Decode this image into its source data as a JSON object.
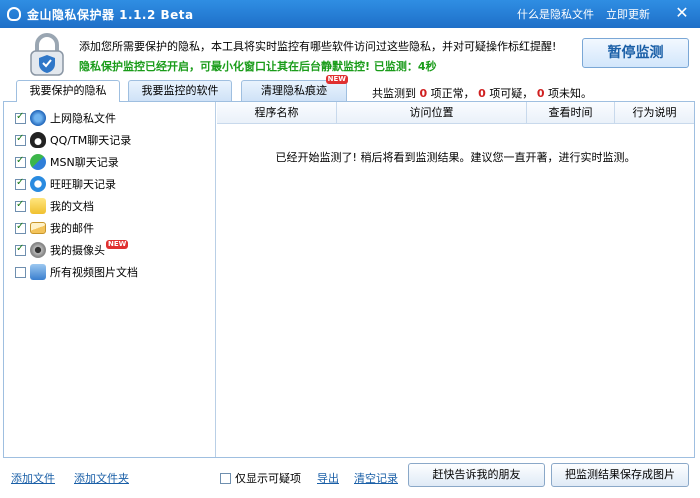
{
  "window": {
    "title": "金山隐私保护器 1.1.2 Beta",
    "link_what": "什么是隐私文件",
    "link_update": "立即更新"
  },
  "header": {
    "description": "添加您所需要保护的隐私，本工具将实时监控有哪些软件访问过这些隐私，并对可疑操作标红提醒!",
    "status": "隐私保护监控已经开启，可最小化窗口让其在后台静默监控! 已监测：4秒",
    "pause_button": "暂停监测"
  },
  "tabs": [
    {
      "label": "我要保护的隐私",
      "active": true
    },
    {
      "label": "我要监控的软件",
      "active": false
    },
    {
      "label": "清理隐私痕迹",
      "active": false,
      "badge": "NEW"
    }
  ],
  "counts": {
    "prefix": "共监测到",
    "normal_count": "0",
    "normal_label": "项正常，",
    "suspicious_count": "0",
    "suspicious_label": "项可疑，",
    "unknown_count": "0",
    "unknown_label": "项未知。"
  },
  "privacy_items": [
    {
      "label": "上网隐私文件",
      "checked": true,
      "icon": "ie-icon"
    },
    {
      "label": "QQ/TM聊天记录",
      "checked": true,
      "icon": "qq-penguin-icon"
    },
    {
      "label": "MSN聊天记录",
      "checked": true,
      "icon": "msn-icon"
    },
    {
      "label": "旺旺聊天记录",
      "checked": true,
      "icon": "wangwang-icon"
    },
    {
      "label": "我的文档",
      "checked": true,
      "icon": "documents-folder-icon"
    },
    {
      "label": "我的邮件",
      "checked": true,
      "icon": "mail-envelope-icon"
    },
    {
      "label": "我的摄像头",
      "checked": true,
      "icon": "webcam-icon",
      "badge": "NEW"
    },
    {
      "label": "所有视频图片文档",
      "checked": false,
      "icon": "media-files-icon"
    }
  ],
  "table": {
    "columns": [
      "程序名称",
      "访问位置",
      "查看时间",
      "行为说明"
    ],
    "empty_message": "已经开始监测了! 稍后将看到监测结果。建议您一直开著，进行实时监测。"
  },
  "footer": {
    "add_file": "添加文件",
    "add_folder": "添加文件夹",
    "only_suspicious": "仅显示可疑项",
    "export": "导出",
    "clear_records": "清空记录",
    "tell_friends": "赶快告诉我的朋友",
    "save_image": "把监测结果保存成图片"
  },
  "colors": {
    "titlebar": "#1e6fc8",
    "status_green": "#1a9c1a",
    "count_red": "#d02020",
    "link_blue": "#1a5fa7"
  }
}
